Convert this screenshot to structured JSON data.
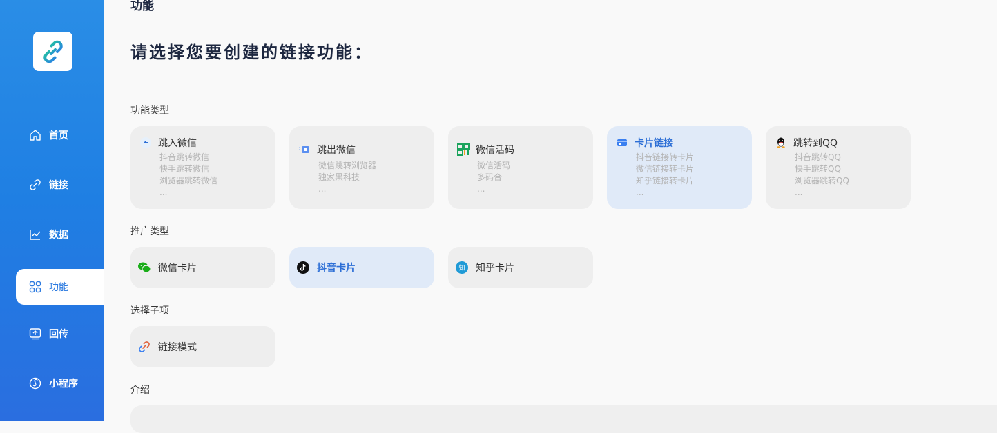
{
  "sidebar": {
    "items": [
      {
        "label": "首页",
        "icon": "home-icon"
      },
      {
        "label": "链接",
        "icon": "link-icon"
      },
      {
        "label": "数据",
        "icon": "chart-icon"
      },
      {
        "label": "功能",
        "icon": "grid-icon"
      },
      {
        "label": "回传",
        "icon": "upload-icon"
      },
      {
        "label": "小程序",
        "icon": "miniprogram-icon"
      }
    ]
  },
  "page": {
    "breadcrumb": "功能",
    "headline": "请选择您要创建的链接功能："
  },
  "sections": {
    "function_type": "功能类型",
    "promo_type": "推广类型",
    "sub_item": "选择子项",
    "intro": "介绍"
  },
  "function_cards": [
    {
      "title": "跳入微信",
      "lines": [
        "抖音跳转微信",
        "快手跳转微信",
        "浏览器跳转微信",
        "..."
      ],
      "icon": "jump-in-icon"
    },
    {
      "title": "跳出微信",
      "lines": [
        "微信跳转浏览器",
        "独家黑科技",
        "..."
      ],
      "icon": "jump-out-icon"
    },
    {
      "title": "微信活码",
      "lines": [
        "微信活码",
        "多码合一",
        "..."
      ],
      "icon": "qrcode-icon"
    },
    {
      "title": "卡片链接",
      "lines": [
        "抖音链接转卡片",
        "微信链接转卡片",
        "知乎链接转卡片",
        "..."
      ],
      "icon": "card-icon"
    },
    {
      "title": "跳转到QQ",
      "lines": [
        "抖音跳转QQ",
        "快手跳转QQ",
        "浏览器跳转QQ",
        "..."
      ],
      "icon": "qq-icon"
    }
  ],
  "promo_cards": [
    {
      "title": "微信卡片",
      "icon": "wechat-icon"
    },
    {
      "title": "抖音卡片",
      "icon": "douyin-icon"
    },
    {
      "title": "知乎卡片",
      "icon": "zhihu-icon"
    }
  ],
  "sub_items": [
    {
      "title": "链接模式",
      "icon": "link-mode-icon"
    }
  ],
  "colors": {
    "accent": "#2d6fd6",
    "sidebar": "#1f7fe3",
    "selected_bg": "#e0eaf8"
  }
}
